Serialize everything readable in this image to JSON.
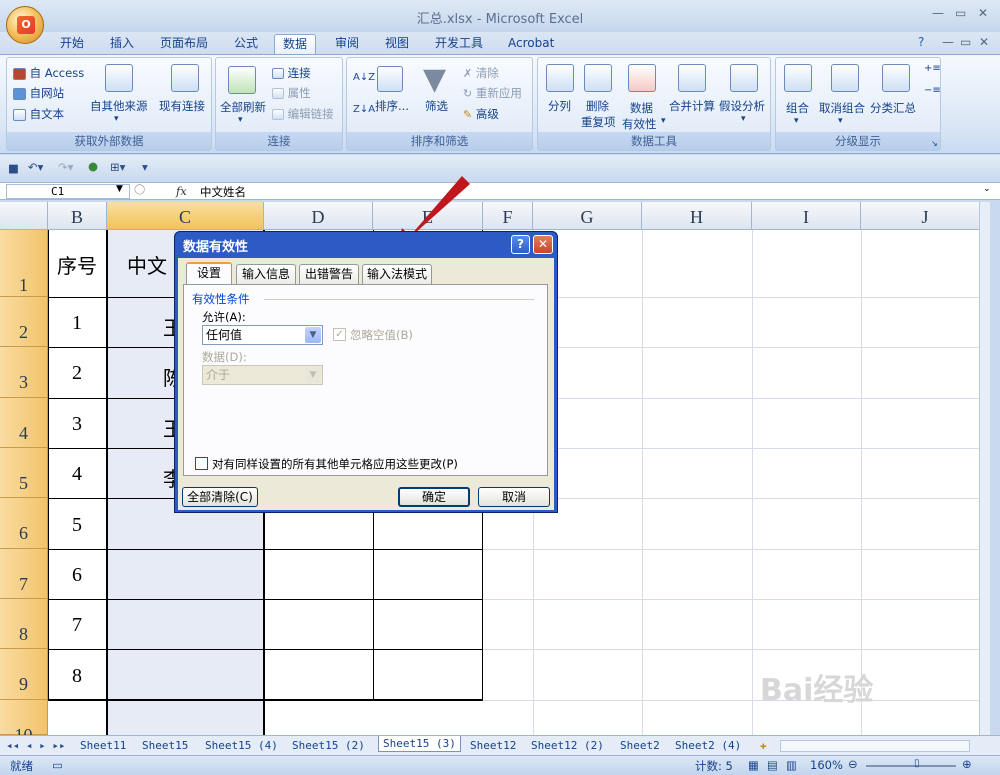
{
  "window": {
    "title": "汇总.xlsx - Microsoft Excel",
    "logo": "O"
  },
  "tabs": [
    "开始",
    "插入",
    "页面布局",
    "公式",
    "数据",
    "审阅",
    "视图",
    "开发工具",
    "Acrobat"
  ],
  "active_tab": "数据",
  "ribbon": {
    "groups": {
      "external": {
        "label": "获取外部数据",
        "access": "自 Access",
        "web": "自网站",
        "text": "自文本",
        "other": "自其他来源",
        "existing": "现有连接"
      },
      "connections": {
        "label": "连接",
        "refresh_all": "全部刷新",
        "connections": "连接",
        "properties": "属性",
        "edit_links": "编辑链接"
      },
      "sort_filter": {
        "label": "排序和筛选",
        "sort": "排序...",
        "filter": "筛选",
        "clear": "清除",
        "reapply": "重新应用",
        "advanced": "高级"
      },
      "data_tools": {
        "label": "数据工具",
        "split": "分列",
        "remove_dup_1": "删除",
        "remove_dup_2": "重复项",
        "validation_1": "数据",
        "validation_2": "有效性",
        "consolidate": "合并计算",
        "whatif": "假设分析"
      },
      "outline": {
        "label": "分级显示",
        "group": "组合",
        "ungroup": "取消组合",
        "subtotal": "分类汇总"
      }
    }
  },
  "formula_bar": {
    "cell_ref": "C1",
    "fx": "fx",
    "content": "中文姓名"
  },
  "columns": [
    "B",
    "C",
    "D",
    "E",
    "F",
    "G",
    "H",
    "I",
    "J"
  ],
  "rows": [
    "1",
    "2",
    "3",
    "4",
    "5",
    "6",
    "7",
    "8",
    "9",
    "10"
  ],
  "cells": {
    "b1": "序号",
    "c1": "中文",
    "b": [
      "1",
      "2",
      "3",
      "4",
      "5",
      "6",
      "7",
      "8"
    ],
    "c": [
      "王",
      "陈",
      "王",
      "李"
    ]
  },
  "dialog": {
    "title": "数据有效性",
    "help": "?",
    "close": "✕",
    "tabs": [
      "设置",
      "输入信息",
      "出错警告",
      "输入法模式"
    ],
    "section": "有效性条件",
    "allow_label": "允许(A):",
    "allow_value": "任何值",
    "ignore_blank": "忽略空值(B)",
    "data_label": "数据(D):",
    "data_value": "介于",
    "apply_all": "对有同样设置的所有其他单元格应用这些更改(P)",
    "clear_all": "全部清除(C)",
    "ok": "确定",
    "cancel": "取消"
  },
  "sheets": [
    "Sheet11",
    "Sheet15",
    "Sheet15 (4)",
    "Sheet15 (2)",
    "Sheet15 (3)",
    "Sheet12",
    "Sheet12 (2)",
    "Sheet2",
    "Sheet2 (4)"
  ],
  "active_sheet": "Sheet15 (3)",
  "status": {
    "ready": "就绪",
    "count": "计数: 5",
    "zoom": "160%"
  },
  "watermark": "Bai经验",
  "colors": {
    "accent": "#2c5bc5",
    "arrow": "#c0171c",
    "row_header": "#f1c36a"
  }
}
